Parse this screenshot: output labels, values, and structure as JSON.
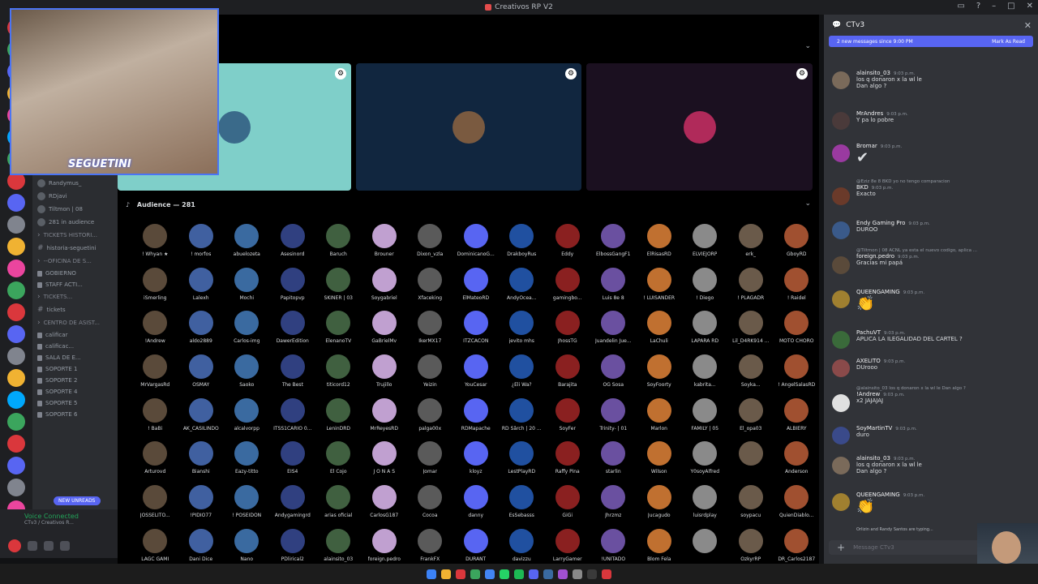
{
  "window": {
    "title": "Creativos RP V2"
  },
  "sidebar": {
    "rows": [
      {
        "label": "Randymus_",
        "kind": "user"
      },
      {
        "label": "RDjavi",
        "kind": "user"
      },
      {
        "label": "Tiltmon | 08",
        "kind": "user"
      },
      {
        "label": "281 in audience",
        "kind": "user"
      },
      {
        "label": "TICKETS HISTORI...",
        "kind": "category"
      },
      {
        "label": "historia-seguetini",
        "kind": "channel"
      },
      {
        "label": "--OFICINA DE S...",
        "kind": "category"
      },
      {
        "label": "GOBIERNO",
        "kind": "locked"
      },
      {
        "label": "STAFF ACTI...",
        "kind": "locked"
      },
      {
        "label": "TICKETS...",
        "kind": "category"
      },
      {
        "label": "tickets",
        "kind": "channel"
      },
      {
        "label": "CENTRO DE ASIST...",
        "kind": "category"
      },
      {
        "label": "calificar",
        "kind": "locked"
      },
      {
        "label": "calificac...",
        "kind": "locked"
      },
      {
        "label": "SALA DE E...",
        "kind": "locked"
      },
      {
        "label": "SOPORTE 1",
        "kind": "locked"
      },
      {
        "label": "SOPORTE 2",
        "kind": "locked"
      },
      {
        "label": "SOPORTE 4",
        "kind": "locked"
      },
      {
        "label": "SOPORTE 5",
        "kind": "locked"
      },
      {
        "label": "SOPORTE 6",
        "kind": "locked"
      }
    ],
    "new_unreads": "NEW UNREADS",
    "voice_title": "Voice Connected",
    "voice_sub": "CTv3 / Creativos R..."
  },
  "stream": {
    "streamer_tag": "SEGUETINI"
  },
  "stage": {
    "audience_title": "Audience — 281",
    "audience": [
      "! Whyan ★",
      "! morfos",
      "abuelozeta",
      "Asesinord",
      "Baruch",
      "Brouner",
      "Dixon_vzla",
      "DominicanoG...",
      "DrakboyRus",
      "Eddy",
      "ElbossGangF1",
      "ElRisasRD",
      "ELVIEJORP",
      "erk_",
      "GboyRD",
      "iSmerling",
      "Lalexh",
      "Mochi",
      "Papitopvp",
      "SKINER | 03",
      "Soygabriel",
      "Xfaceking",
      "ElMateoRD",
      "AndyOcea...",
      "gamingbo...",
      "Luis 8e 8",
      "! LUISANDER",
      "! Diego",
      "! PLAGADR",
      "! Raidel",
      "!Andrew",
      "aldo2889",
      "Carlos-img",
      "DawerEdition",
      "ElenanoTV",
      "GaBrielMv",
      "IkerMX17",
      "ITZCACON",
      "jevito mhs",
      "JhossTG",
      "Juandelin Jue...",
      "LaChuli",
      "LAPARA RD",
      "Lil_D4RK914 ...",
      "MOTO CHORO",
      "MrVargasRd",
      "OSMAY",
      "Saoko",
      "The Best",
      "titicord12",
      "Trujillo",
      "Yeizin",
      "YouCesar",
      "¿Eli Wa?",
      "Barajita",
      "OG Sosa",
      "SoyFoorty",
      "kabrita...",
      "Soyka...",
      "! AngelSalasRD",
      "! BaBi",
      "AK_CASILINDO",
      "alcalvorpp",
      "ITSS1CARIO 0...",
      "LeninDRD",
      "MrReyesRD",
      "palga00x",
      "RDMapache",
      "RD Sârch | 20 ...",
      "SoyFer",
      "Trinity- | 01",
      "Marlon",
      "FAMILY | 05",
      "El_opa03",
      "ALBIERY",
      "Arturovd",
      "Bianshi",
      "Eazy-titto",
      "EIS4",
      "El Cojo",
      "J O N A S",
      "Jomar",
      "kloyz",
      "LestPlayRD",
      "Raffy Pina",
      "starlin",
      "Wilson",
      "Y0soyAlfred",
      "",
      "Anderson",
      "JOSSELITO...",
      "!PIDIO77",
      "! POSEIDON",
      "Andygamingrd",
      "arias oficial",
      "CarlosG187",
      "Cocoa",
      "danny",
      "EsSebasss",
      "GiGi",
      "Jhrzmz",
      "Jucagudo",
      "luisrdplay",
      "soypacu",
      "QuienDiablo...",
      "LAGC GAMI",
      "Dani Dice",
      "Nano",
      "PDlirical2",
      "alainsito_03",
      "foreign.pedro",
      "FrankFX",
      "DURANT",
      "davizzu",
      "LarryGamer",
      "!UNITADO",
      "Blom Fela",
      "",
      "OzkyrRP",
      "DR_Carlos2187"
    ]
  },
  "chat": {
    "title": "CTv3",
    "banner_text": "2 new messages since 9:00 PM",
    "mark_read": "Mark As Read",
    "typing": "Orlizin and Randy Santos are typing...",
    "placeholder": "Message CTv3",
    "messages": [
      {
        "name": "alainsito_03",
        "time": "9:03 p.m.",
        "body": "los q donaron x la wl le",
        "body2": "Dan algo ?",
        "reply": "",
        "emoji": ""
      },
      {
        "name": "MrAndres",
        "time": "9:03 p.m.",
        "body": "Y pa lo pobre",
        "body2": "",
        "reply": "",
        "emoji": ""
      },
      {
        "name": "Bromar",
        "time": "9:03 p.m.",
        "body": "",
        "body2": "",
        "reply": "",
        "emoji": "✔"
      },
      {
        "name": "BKD",
        "time": "9:03 p.m.",
        "body": "Exacto",
        "body2": "",
        "reply": "@Eziz 8e 8 BKD yo no tengo comparacion",
        "emoji": ""
      },
      {
        "name": "Endy Gaming Pro",
        "time": "9:03 p.m.",
        "body": "DUROO",
        "body2": "",
        "reply": "",
        "emoji": ""
      },
      {
        "name": "foreign.pedro",
        "time": "9:03 p.m.",
        "body": "Gracias mi papá",
        "body2": "",
        "reply": "@Tiltmon | 08 ACNL ya esta el nuevo codigo, aplica ...",
        "emoji": ""
      },
      {
        "name": "QUEENGAMING",
        "time": "9:03 p.m.",
        "body": "",
        "body2": "",
        "reply": "",
        "emoji": "👏"
      },
      {
        "name": "PachuVT",
        "time": "9:03 p.m.",
        "body": "APLICA LA ILEGALIDAD DEL CARTEL ?",
        "body2": "",
        "reply": "",
        "emoji": ""
      },
      {
        "name": "AXELITO",
        "time": "9:03 p.m.",
        "body": "DUrooo",
        "body2": "",
        "reply": "",
        "emoji": ""
      },
      {
        "name": "!Andrew",
        "time": "9:03 p.m.",
        "body": "x2 JAJAJAJ",
        "body2": "",
        "reply": "@alainsito_03 los q donaron x la wl le Dan algo ?",
        "emoji": ""
      },
      {
        "name": "SoyMartinTV",
        "time": "9:03 p.m.",
        "body": "duro",
        "body2": "",
        "reply": "",
        "emoji": ""
      },
      {
        "name": "alainsito_03",
        "time": "9:03 p.m.",
        "body": "los q donaron x la wl le",
        "body2": "Dan algo ?",
        "reply": "",
        "emoji": ""
      },
      {
        "name": "QUEENGAMING",
        "time": "9:03 p.m.",
        "body": "",
        "body2": "",
        "reply": "",
        "emoji": "👏"
      }
    ]
  },
  "colors": {
    "accent": "#5865f2",
    "speaker1": "#7fcfc9",
    "speaker2": "#11263f",
    "speaker3": "#1b1020"
  }
}
